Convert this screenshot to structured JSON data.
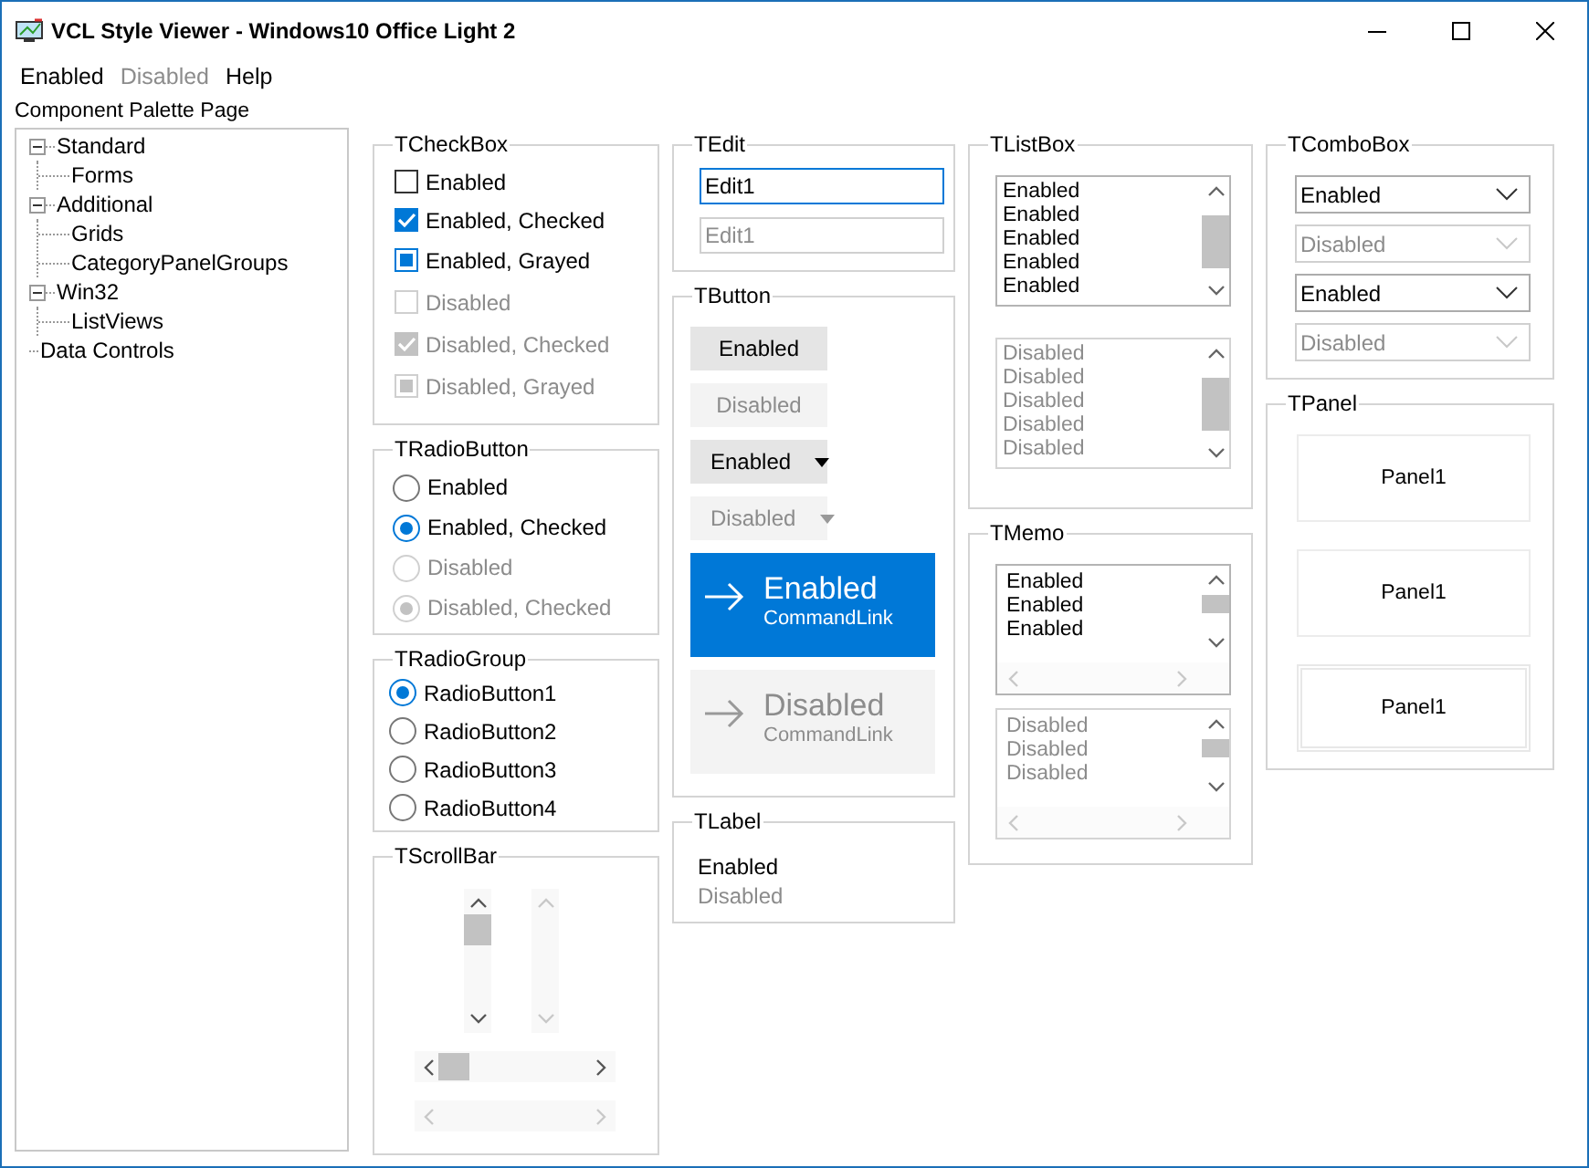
{
  "window": {
    "title": "VCL Style Viewer - Windows10 Office Light 2"
  },
  "menu": [
    {
      "label": "Enabled",
      "disabled": false
    },
    {
      "label": "Disabled",
      "disabled": true
    },
    {
      "label": "Help",
      "disabled": false
    }
  ],
  "palette": {
    "label": "Component Palette Page",
    "tree": [
      {
        "label": "Standard",
        "expanded": true,
        "children": [
          {
            "label": "Forms"
          }
        ]
      },
      {
        "label": "Additional",
        "expanded": true,
        "children": [
          {
            "label": "Grids"
          },
          {
            "label": "CategoryPanelGroups"
          }
        ]
      },
      {
        "label": "Win32",
        "expanded": true,
        "children": [
          {
            "label": "ListViews"
          }
        ]
      },
      {
        "label": "Data Controls"
      }
    ]
  },
  "columns": [
    [
      {
        "kind": "checkbox",
        "title": "TCheckBox",
        "items": [
          {
            "label": "Enabled",
            "checked": false,
            "grayed": false,
            "disabled": false
          },
          {
            "label": "Enabled, Checked",
            "checked": true,
            "grayed": false,
            "disabled": false
          },
          {
            "label": "Enabled, Grayed",
            "checked": false,
            "grayed": true,
            "disabled": false
          },
          {
            "label": "Disabled",
            "checked": false,
            "grayed": false,
            "disabled": true
          },
          {
            "label": "Disabled, Checked",
            "checked": true,
            "grayed": false,
            "disabled": true
          },
          {
            "label": "Disabled, Grayed",
            "checked": false,
            "grayed": true,
            "disabled": true
          }
        ]
      },
      {
        "kind": "radio",
        "title": "TRadioButton",
        "items": [
          {
            "label": "Enabled",
            "checked": false,
            "disabled": false
          },
          {
            "label": "Enabled, Checked",
            "checked": true,
            "disabled": false
          },
          {
            "label": "Disabled",
            "checked": false,
            "disabled": true
          },
          {
            "label": "Disabled, Checked",
            "checked": true,
            "disabled": true
          }
        ]
      },
      {
        "kind": "radiogroup",
        "title": "TRadioGroup",
        "items": [
          {
            "label": "RadioButton1",
            "selected": true
          },
          {
            "label": "RadioButton2",
            "selected": false
          },
          {
            "label": "RadioButton3",
            "selected": false
          },
          {
            "label": "RadioButton4",
            "selected": false
          }
        ]
      },
      {
        "kind": "scrollbar",
        "title": "TScrollBar",
        "items": [
          {
            "kind": "vertical",
            "disabled": false
          },
          {
            "kind": "vertical",
            "disabled": true
          },
          {
            "kind": "horizontal",
            "disabled": false
          },
          {
            "kind": "horizontal",
            "disabled": true
          }
        ]
      }
    ],
    [
      {
        "kind": "edit",
        "title": "TEdit",
        "items": [
          {
            "value": "Edit1",
            "focused": true,
            "disabled": false
          },
          {
            "value": "Edit1",
            "focused": false,
            "disabled": true
          }
        ]
      },
      {
        "kind": "button",
        "title": "TButton",
        "items": [
          {
            "kind": "push",
            "label": "Enabled",
            "disabled": false
          },
          {
            "kind": "push",
            "label": "Disabled",
            "disabled": true
          },
          {
            "kind": "split",
            "label": "Enabled",
            "disabled": false
          },
          {
            "kind": "split",
            "label": "Disabled",
            "disabled": true
          },
          {
            "kind": "commandlink",
            "label": "Enabled",
            "note": "CommandLink",
            "disabled": false
          },
          {
            "kind": "commandlink",
            "label": "Disabled",
            "note": "CommandLink",
            "disabled": true
          }
        ]
      },
      {
        "kind": "label",
        "title": "TLabel",
        "items": [
          {
            "label": "Enabled",
            "disabled": false
          },
          {
            "label": "Disabled",
            "disabled": true
          }
        ]
      }
    ],
    [
      {
        "kind": "listbox",
        "title": "TListBox",
        "items": [
          {
            "lines": [
              "Enabled",
              "Enabled",
              "Enabled",
              "Enabled",
              "Enabled"
            ],
            "disabled": false
          },
          {
            "lines": [
              "Disabled",
              "Disabled",
              "Disabled",
              "Disabled",
              "Disabled"
            ],
            "disabled": true
          }
        ]
      },
      {
        "kind": "memo",
        "title": "TMemo",
        "items": [
          {
            "lines": [
              "Enabled",
              "Enabled",
              "Enabled"
            ],
            "disabled": false
          },
          {
            "lines": [
              "Disabled",
              "Disabled",
              "Disabled"
            ],
            "disabled": true
          }
        ]
      }
    ],
    [
      {
        "kind": "combobox",
        "title": "TComboBox",
        "items": [
          {
            "value": "Enabled",
            "disabled": false
          },
          {
            "value": "Disabled",
            "disabled": true
          },
          {
            "value": "Enabled",
            "disabled": false
          },
          {
            "value": "Disabled",
            "disabled": true
          }
        ]
      },
      {
        "kind": "panel",
        "title": "TPanel",
        "items": [
          {
            "label": "Panel1",
            "kind": "flat"
          },
          {
            "label": "Panel1",
            "kind": "flat"
          },
          {
            "label": "Panel1",
            "kind": "lowered"
          }
        ]
      }
    ]
  ]
}
